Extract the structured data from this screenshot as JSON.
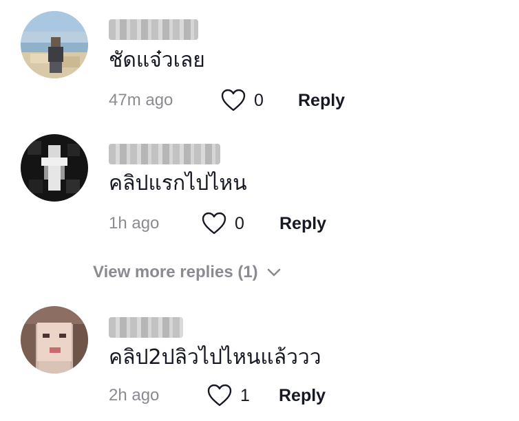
{
  "comments": [
    {
      "username": "",
      "text": "ชัดแจ๋วเลย",
      "time": "47m ago",
      "likes": "0",
      "reply_label": "Reply",
      "avatar_style": "beach-photo-pixelated"
    },
    {
      "username": "",
      "text": "คลิปแรกไปไหน",
      "time": "1h ago",
      "likes": "0",
      "reply_label": "Reply",
      "avatar_style": "dark-photo-pixelated"
    },
    {
      "username": "",
      "text": "คลิป2ปลิวไปไหนแล้ววว",
      "time": "2h ago",
      "likes": "1",
      "reply_label": "Reply",
      "avatar_style": "portrait-photo-pixelated"
    }
  ],
  "view_more": {
    "label": "View more replies (1)",
    "icon": "chevron-down-icon"
  },
  "icons": {
    "like": "heart-outline-icon"
  },
  "colors": {
    "text": "#161823",
    "secondary": "#8a8b91",
    "background": "#ffffff"
  }
}
